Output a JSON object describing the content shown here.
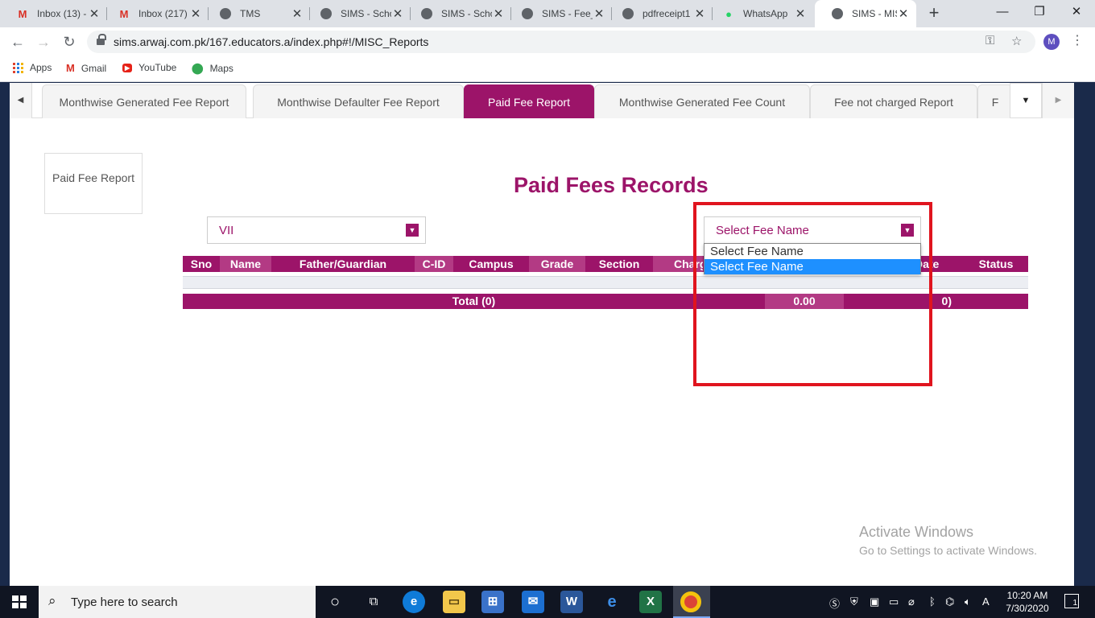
{
  "browser": {
    "tabs": [
      {
        "title": "Inbox (13) -",
        "icon": "gmail-icon"
      },
      {
        "title": "Inbox (217)",
        "icon": "gmail-icon"
      },
      {
        "title": "TMS",
        "icon": "globe-icon"
      },
      {
        "title": "SIMS - Scho",
        "icon": "globe-icon"
      },
      {
        "title": "SIMS - Scho",
        "icon": "globe-icon"
      },
      {
        "title": "SIMS - Fee_",
        "icon": "globe-icon"
      },
      {
        "title": "pdfreceipt1",
        "icon": "globe-icon"
      },
      {
        "title": "WhatsApp",
        "icon": "whatsapp-icon"
      },
      {
        "title": "SIMS - MIS",
        "icon": "globe-icon"
      }
    ],
    "url": "sims.arwaj.com.pk/167.educators.a/index.php#!/MISC_Reports",
    "profile_initial": "M",
    "bookmarks": [
      "Apps",
      "Gmail",
      "YouTube",
      "Maps"
    ]
  },
  "page": {
    "report_tabs": [
      "Monthwise Generated Fee Report",
      "Monthwise Defaulter Fee Report",
      "Paid Fee Report",
      "Monthwise Generated Fee Count",
      "Fee not charged Report",
      "F"
    ],
    "active_report_tab": "Paid Fee Report",
    "side_card": "Paid Fee Report",
    "title": "Paid Fees Records",
    "grade_select": {
      "value": "VII"
    },
    "fee_select": {
      "value": "Select Fee Name",
      "options": [
        "Select Fee Name",
        "Select Fee Name"
      ],
      "highlighted_index": 1
    },
    "table": {
      "columns": [
        "Sno",
        "Name",
        "Father/Guardian",
        "C-ID",
        "Campus",
        "Grade",
        "Section",
        "Charg",
        "Date",
        "Status"
      ],
      "total_label": "Total (0)",
      "total_amount": "0.00",
      "total_count_fragment": "0)"
    },
    "watermark": {
      "line1": "Activate Windows",
      "line2": "Go to Settings to activate Windows."
    }
  },
  "taskbar": {
    "search_placeholder": "Type here to search",
    "time": "10:20 AM",
    "date": "7/30/2020",
    "notification_count": "1"
  },
  "colors": {
    "brand": "#9c1469",
    "brand_alt": "#b33a84",
    "highlight": "#1e90ff",
    "annotation_red": "#e0141e"
  }
}
